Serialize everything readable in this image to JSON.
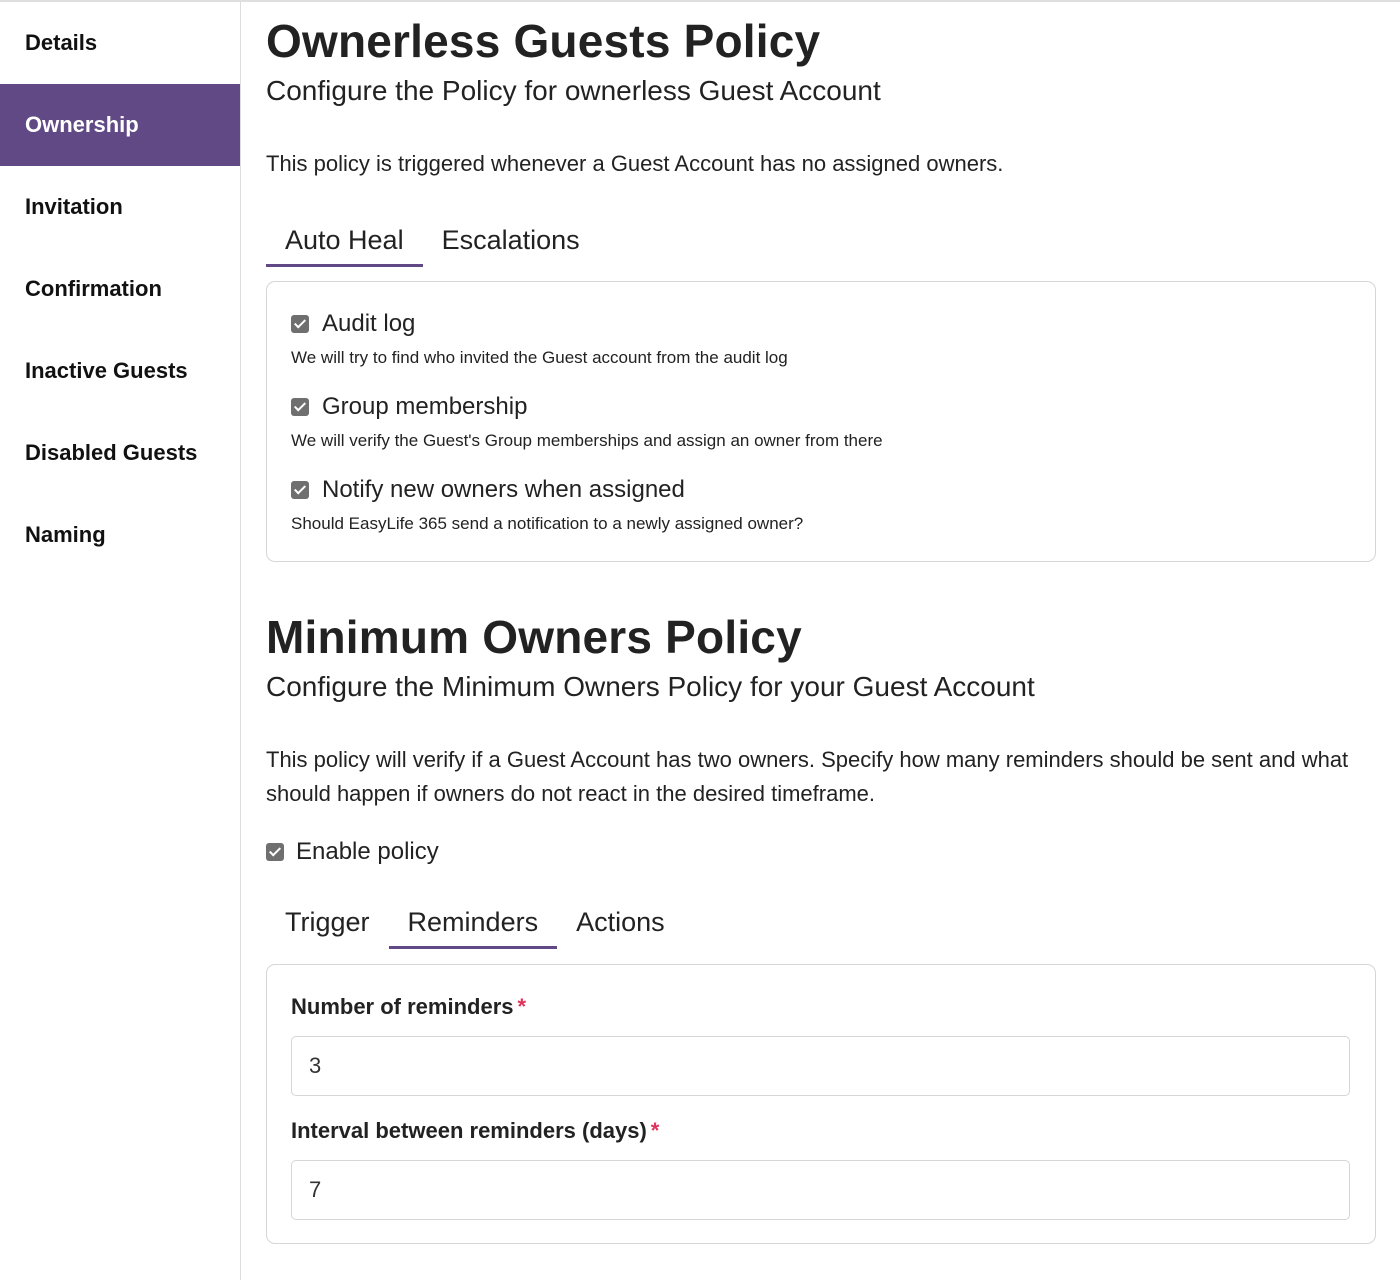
{
  "sidebar": {
    "items": [
      {
        "label": "Details",
        "active": false
      },
      {
        "label": "Ownership",
        "active": true
      },
      {
        "label": "Invitation",
        "active": false
      },
      {
        "label": "Confirmation",
        "active": false
      },
      {
        "label": "Inactive Guests",
        "active": false
      },
      {
        "label": "Disabled Guests",
        "active": false
      },
      {
        "label": "Naming",
        "active": false
      }
    ]
  },
  "ownerless": {
    "title": "Ownerless Guests Policy",
    "subtitle": "Configure the Policy for ownerless Guest Account",
    "description": "This policy is triggered whenever a Guest Account has no assigned owners.",
    "tabs": [
      {
        "label": "Auto Heal",
        "active": true
      },
      {
        "label": "Escalations",
        "active": false
      }
    ],
    "options": [
      {
        "label": "Audit log",
        "checked": true,
        "hint": "We will try to find who invited the Guest account from the audit log"
      },
      {
        "label": "Group membership",
        "checked": true,
        "hint": "We will verify the Guest's Group memberships and assign an owner from there"
      },
      {
        "label": "Notify new owners when assigned",
        "checked": true,
        "hint": "Should EasyLife 365 send a notification to a newly assigned owner?"
      }
    ]
  },
  "minimum": {
    "title": "Minimum Owners Policy",
    "subtitle": "Configure the Minimum Owners Policy for your Guest Account",
    "description": "This policy will verify if a Guest Account has two owners. Specify how many reminders should be sent and what should happen if owners do not react in the desired timeframe.",
    "enable_label": "Enable policy",
    "enable_checked": true,
    "tabs": [
      {
        "label": "Trigger",
        "active": false
      },
      {
        "label": "Reminders",
        "active": true
      },
      {
        "label": "Actions",
        "active": false
      }
    ],
    "fields": [
      {
        "label": "Number of reminders",
        "required_mark": "*",
        "value": "3"
      },
      {
        "label": "Interval between reminders (days)",
        "required_mark": "*",
        "value": "7"
      }
    ]
  },
  "colors": {
    "accent": "#614985",
    "required": "#e0325b",
    "checkbox": "#6f6f6f"
  }
}
